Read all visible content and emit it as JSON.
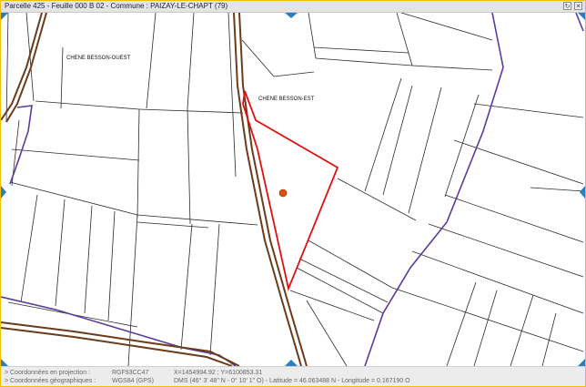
{
  "window": {
    "title": "Parcelle 425 - Feuille 000 B 02 - Commune : PAIZAY-LE-CHAPT (79)",
    "buttons": [
      {
        "name": "refresh-button",
        "icon": "refresh-icon",
        "glyph": "↻"
      },
      {
        "name": "close-button",
        "icon": "close-icon",
        "glyph": "✕"
      }
    ]
  },
  "map": {
    "labels": {
      "west": "CHENE BESSON-OUEST",
      "east": "CHENE BESSON-EST"
    },
    "colors": {
      "parcel_lines": "#222222",
      "selected_parcel": "#e01010",
      "section_boundary": "#5a3a9a",
      "road": "#6b3b1a",
      "nav_arrows": "#2a7fc0",
      "marker": "#e05010"
    },
    "nav": {
      "top": "pan-north-arrow",
      "bottom": "pan-south-arrow",
      "left": "pan-west-arrow",
      "right": "pan-east-arrow"
    }
  },
  "status": {
    "projection": {
      "label": "> Coordonnées en projection :",
      "system": "RGF93CC47",
      "value": "X=1454994.92 ; Y=6100853.31"
    },
    "geographic": {
      "label": "> Coordonnées géographiques :",
      "system": "WGS84 (GPS)",
      "value": "DMS (46° 3' 48\" N - 0° 10' 1\" O) - Latitude = 46.063488 N - Longitude = 0.167190 O"
    }
  }
}
